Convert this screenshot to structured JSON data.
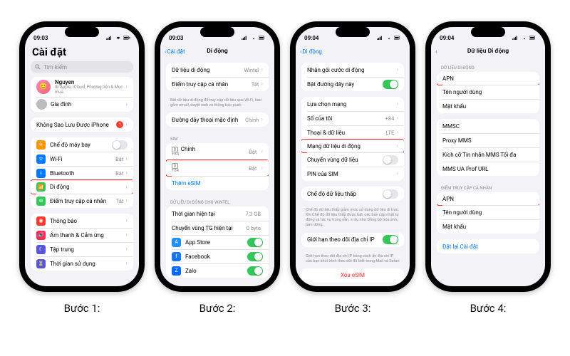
{
  "captions": [
    "Bước 1:",
    "Bước 2:",
    "Bước 3:",
    "Bước 4:"
  ],
  "status": {
    "t1": "09:03",
    "t2": "09:03",
    "t3": "09:04",
    "t4": "09:04"
  },
  "s1": {
    "title": "Cài đặt",
    "search": "Tìm kiếm",
    "user_name": "Nguyen",
    "user_sub": "ID Apple, iCloud, Phương tiện & Mục mua",
    "family": "Gia đình",
    "backup_warn": "Không Sao Lưu Được iPhone",
    "badge": "1",
    "rows": {
      "airplane": "Chế độ máy bay",
      "wifi": "Wi-Fi",
      "wifi_val": "Bật",
      "bt": "Bluetooth",
      "bt_val": "Bật",
      "cellular": "Di động",
      "hotspot": "Điểm truy cập cá nhân",
      "hotspot_val": "Tắt"
    },
    "rows2": {
      "notif": "Thông báo",
      "sound": "Âm thanh & Cảm ứng",
      "focus": "Tập trung",
      "screentime": "Thời gian sử dụng"
    }
  },
  "s2": {
    "back": "Cài đặt",
    "title": "Di động",
    "cell_data": "Dữ liệu di động",
    "cell_data_val": "Wintel",
    "hotspot": "Điểm truy cập cá nhân",
    "hotspot_val": "Tắt",
    "hotspot_note": "Bật dữ liệu di động để truy cập dữ liệu qua Wi-Fi, bao gồm email, duyệt web và thông báo push",
    "default_line": "Đường dây thoại mặc định",
    "default_line_val": "Chính",
    "sim_header": "SIM",
    "sim1_label": "Chính",
    "sim1_num": "+84",
    "sim1_val": "Bật",
    "sim2_label": "",
    "sim2_num": "+84",
    "sim2_val": "Bật",
    "add_esim": "Thêm eSIM",
    "usage_header": "DỮ LIỆU DI ĐỘNG CHO WINTEL",
    "period": "Thời gian hiện tại",
    "period_val": "7,3 GB",
    "roam_period": "Chuyển vùng TG hiện tại",
    "roam_period_val": "0 byte",
    "appstore": "App Store",
    "facebook": "Facebook",
    "zalo": "Zalo"
  },
  "s3": {
    "back": "Di động",
    "title": "",
    "plan": "Nhãn gói cước di động",
    "enable": "Bật đường dây này",
    "netsel": "Lựa chọn mạng",
    "mynum": "Số của tôi",
    "mynum_val": "+84",
    "voice": "Thoại & dữ liệu",
    "voice_val": "LTE",
    "data_net": "Mạng dữ liệu di động",
    "roam": "Chuyển vùng dữ liệu",
    "sim_pin": "PIN của SIM",
    "low_header": "",
    "low": "Chế độ dữ liệu thấp",
    "low_note": "Chế độ dữ liệu thấp giảm mức sử dụng dữ liệu dì trực. Khi Chế độ dữ liệu thấp được bật, các bản cập nhật tự động và tác vụ trong nền, ví dụ như Đồng bộ hóa ảnh, tạm dừng.",
    "ip_limit": "Giới hạn theo dõi địa chỉ IP",
    "ip_note": "Giới hạn theo dõi địa chỉ IP bằng cách ẩn địa chỉ IP của bạn khỏi trình theo dõi đã biết trong Mail và Safari",
    "del_esim": "Xóa eSIM"
  },
  "s4": {
    "title": "Dữ liệu Di động",
    "h1": "DỮ LIỆU DI ĐỘNG",
    "apn": "APN",
    "user": "Tên người dùng",
    "pass": "Mật khẩu",
    "mmsc": "MMSC",
    "proxy": "Proxy MMS",
    "maxsize": "Kích cỡ Tin nhắn MMS Tối đa",
    "uaprof": "MMS UA Prof URL",
    "h2": "ĐIỂM TRUY CẬP CÁ NHÂN",
    "reset": "Đặt lại Cài đặt"
  }
}
